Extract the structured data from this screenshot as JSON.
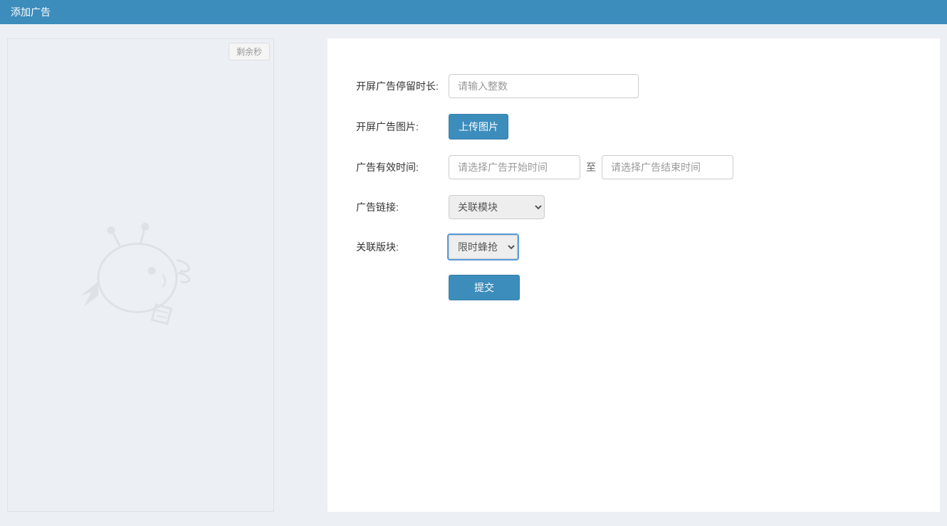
{
  "header": {
    "title": "添加广告"
  },
  "preview": {
    "countdown_label": "剩余秒"
  },
  "form": {
    "duration": {
      "label": "开屏广告停留时长:",
      "placeholder": "请输入整数"
    },
    "image": {
      "label": "开屏广告图片:",
      "button": "上传图片"
    },
    "valid_time": {
      "label": "广告有效时间:",
      "start_placeholder": "请选择广告开始时间",
      "separator": "至",
      "end_placeholder": "请选择广告结束时间"
    },
    "link": {
      "label": "广告链接:",
      "selected": "关联模块"
    },
    "section": {
      "label": "关联版块:",
      "selected": "限时蜂抢"
    },
    "submit": {
      "button": "提交"
    }
  }
}
